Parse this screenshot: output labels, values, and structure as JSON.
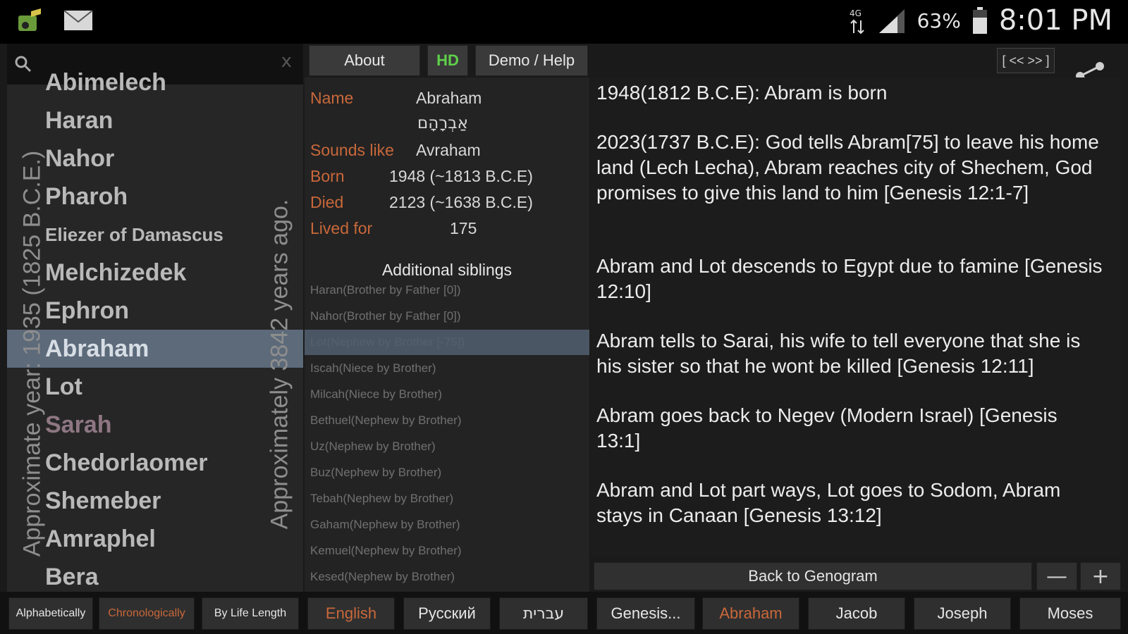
{
  "status": {
    "battery": "63%",
    "time": "8:01 PM"
  },
  "search": {
    "placeholder": "",
    "clear": "x"
  },
  "names": [
    {
      "label": "Abimelech"
    },
    {
      "label": "Haran"
    },
    {
      "label": "Nahor"
    },
    {
      "label": "Pharoh"
    },
    {
      "label": "Eliezer of Damascus"
    },
    {
      "label": "Melchizedek"
    },
    {
      "label": "Ephron"
    },
    {
      "label": "Abraham"
    },
    {
      "label": "Lot"
    },
    {
      "label": "Sarah"
    },
    {
      "label": "Chedorlaomer"
    },
    {
      "label": "Shemeber"
    },
    {
      "label": "Amraphel"
    },
    {
      "label": "Bera"
    }
  ],
  "vertical": {
    "left": "Approximate year: 1935 (1825 B.C.E.)",
    "right": "Approximately 3842 years ago."
  },
  "tabs": {
    "about": "About",
    "hd": "HD",
    "demo": "Demo / Help"
  },
  "nav": {
    "prevnext": "[ << >> ]"
  },
  "details": {
    "name_label": "Name",
    "name_value": "Abraham",
    "hebrew": "אַבְרָהָם",
    "sounds_label": "Sounds like",
    "sounds_value": "Avraham",
    "born_label": "Born",
    "born_value": "1948 (~1813 B.C.E)",
    "died_label": "Died",
    "died_value": "2123 (~1638 B.C.E)",
    "lived_label": "Lived for",
    "lived_value": "175",
    "siblings_title": "Additional siblings",
    "siblings": [
      {
        "label": "Haran(Brother by Father [0])"
      },
      {
        "label": "Nahor(Brother by Father [0])"
      },
      {
        "label": "Lot(Nephew by Brother [-75])"
      },
      {
        "label": "Iscah(Niece by Brother)"
      },
      {
        "label": "Milcah(Niece by Brother)"
      },
      {
        "label": "Bethuel(Nephew by Brother)"
      },
      {
        "label": "Uz(Nephew by Brother)"
      },
      {
        "label": "Buz(Nephew by Brother)"
      },
      {
        "label": "Tebah(Nephew by Brother)"
      },
      {
        "label": "Gaham(Nephew by Brother)"
      },
      {
        "label": "Kemuel(Nephew by Brother)"
      },
      {
        "label": "Kesed(Nephew by Brother)"
      }
    ]
  },
  "events": [
    "1948(1812 B.C.E): Abram is born",
    "2023(1737 B.C.E): God tells Abram[75] to leave his home land (Lech Lecha), Abram reaches city of Shechem, God promises to give this land to him [Genesis 12:1-7]",
    "Abram and Lot descends to Egypt due to famine [Genesis 12:10]",
    "Abram tells to Sarai, his wife to tell everyone that she is his sister so that he wont be killed [Genesis 12:11]",
    "Abram goes back to Negev (Modern Israel) [Genesis 13:1]",
    "Abram and Lot part ways, Lot goes to Sodom, Abram stays in Canaan [Genesis 13:12]"
  ],
  "controls": {
    "back": "Back to Genogram",
    "minus": "—",
    "plus": "+"
  },
  "bottom": {
    "alphabetically": "Alphabetically",
    "chronologically": "Chronologically",
    "bylife": "By Life Length",
    "english": "English",
    "russian": "Русский",
    "hebrew": "עברית",
    "genesis": "Genesis...",
    "abraham": "Abraham",
    "jacob": "Jacob",
    "joseph": "Joseph",
    "moses": "Moses"
  },
  "colors": {
    "accent": "#c9683a",
    "hd": "#5fd04a",
    "selected": "#5c6a7a"
  }
}
